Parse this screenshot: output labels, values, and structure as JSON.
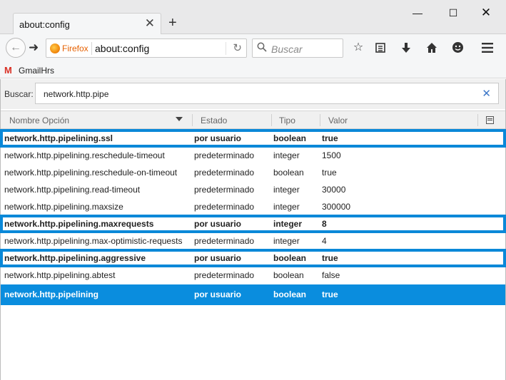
{
  "tab": {
    "title": "about:config"
  },
  "window": {
    "minimize": "—",
    "maximize": "☐",
    "close": "✕"
  },
  "nav": {
    "identity_label": "Firefox",
    "url": "about:config",
    "search_placeholder": "Buscar"
  },
  "bookmarks": [
    {
      "label": "GmailHrs",
      "icon": "gmail-icon"
    }
  ],
  "filter": {
    "label": "Buscar:",
    "value": "network.http.pipe"
  },
  "columns": {
    "name": "Nombre Opción",
    "state": "Estado",
    "type": "Tipo",
    "value": "Valor"
  },
  "rows": [
    {
      "name": "network.http.pipelining.ssl",
      "state": "por usuario",
      "type": "boolean",
      "value": "true"
    },
    {
      "name": "network.http.pipelining.reschedule-timeout",
      "state": "predeterminado",
      "type": "integer",
      "value": "1500"
    },
    {
      "name": "network.http.pipelining.reschedule-on-timeout",
      "state": "predeterminado",
      "type": "boolean",
      "value": "true"
    },
    {
      "name": "network.http.pipelining.read-timeout",
      "state": "predeterminado",
      "type": "integer",
      "value": "30000"
    },
    {
      "name": "network.http.pipelining.maxsize",
      "state": "predeterminado",
      "type": "integer",
      "value": "300000"
    },
    {
      "name": "network.http.pipelining.maxrequests",
      "state": "por usuario",
      "type": "integer",
      "value": "8"
    },
    {
      "name": "network.http.pipelining.max-optimistic-requests",
      "state": "predeterminado",
      "type": "integer",
      "value": "4"
    },
    {
      "name": "network.http.pipelining.aggressive",
      "state": "por usuario",
      "type": "boolean",
      "value": "true"
    },
    {
      "name": "network.http.pipelining.abtest",
      "state": "predeterminado",
      "type": "boolean",
      "value": "false"
    },
    {
      "name": "network.http.pipelining",
      "state": "por usuario",
      "type": "boolean",
      "value": "true"
    }
  ],
  "colors": {
    "highlight_box": "#0a88d8",
    "selected_row": "#0a8dde",
    "firefox_orange": "#e66000"
  }
}
